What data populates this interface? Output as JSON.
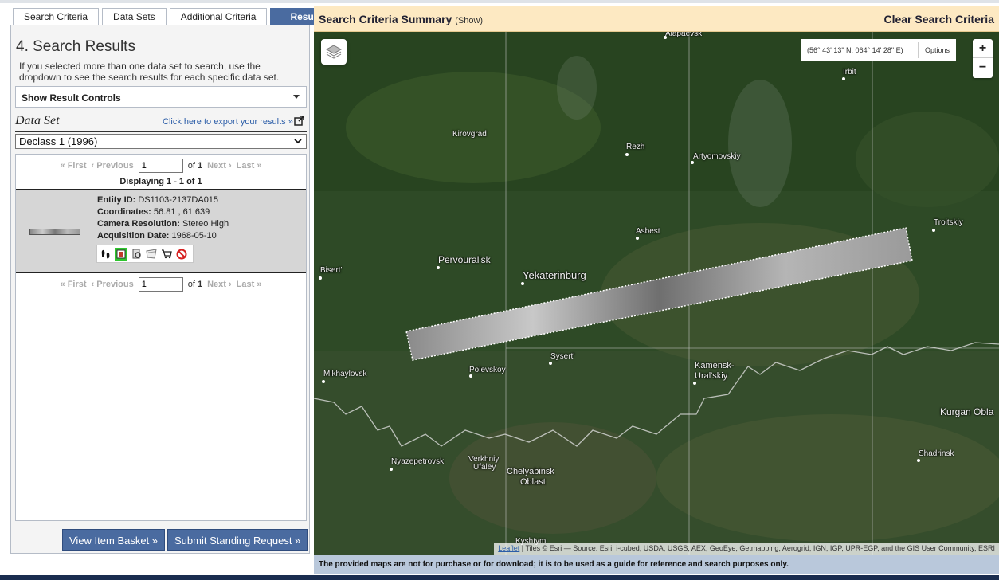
{
  "tabs": [
    {
      "label": "Search Criteria"
    },
    {
      "label": "Data Sets"
    },
    {
      "label": "Additional Criteria"
    },
    {
      "label": "Results"
    }
  ],
  "left": {
    "heading": "4. Search Results",
    "intro": "If you selected more than one data set to search, use the dropdown to see the search results for each specific data set.",
    "result_controls": "Show Result Controls",
    "dataset_label": "Data Set",
    "export_link": "Click here to export your results »",
    "dataset_selected": "Declass 1 (1996)"
  },
  "pager": {
    "first": "« First",
    "previous": "‹ Previous",
    "page": "1",
    "of": "of",
    "total": "1",
    "next": "Next ›",
    "last": "Last »"
  },
  "displaying": "Displaying 1 - 1 of 1",
  "result": {
    "entity_label": "Entity ID:",
    "entity_value": "DS1103-2137DA015",
    "coords_label": "Coordinates:",
    "coords_value": "56.81 , 61.639",
    "res_label": "Camera Resolution:",
    "res_value": "Stereo High",
    "date_label": "Acquisition Date:",
    "date_value": "1968-05-10"
  },
  "buttons": {
    "basket": "View Item Basket »",
    "standing": "Submit Standing Request »"
  },
  "map_header": {
    "title": "Search Criteria Summary",
    "show": "(Show)",
    "clear": "Clear Search Criteria"
  },
  "map": {
    "coordinates": "(56° 43' 13\" N, 064° 14' 28\" E)",
    "options": "Options",
    "zoom_in": "+",
    "zoom_out": "−",
    "leaflet": "Leaflet",
    "attribution": "| Tiles © Esri — Source: Esri, i-cubed, USDA, USGS, AEX, GeoEye, Getmapping, Aerogrid, IGN, IGP, UPR-EGP, and the GIS User Community, ESRI",
    "labels": {
      "alapaevsk": "Alapaevsk",
      "irbit": "Irbit",
      "kirovgrad": "Kirovgrad",
      "rezh": "Rezh",
      "artyomovsky": "Artyomovskiy",
      "asbest": "Asbest",
      "troitskiy": "Troitskiy",
      "pervouralsk": "Pervoural'sk",
      "bisert": "Bisert'",
      "yekaterinburg": "Yekaterinburg",
      "sysert": "Sysert'",
      "polevskoy": "Polevskoy",
      "mikhaylovsk": "Mikhaylovsk",
      "kamensk1": "Kamensk-",
      "kamensk2": "Ural'skiy",
      "kurgan": "Kurgan Obla",
      "shadrinsk": "Shadrinsk",
      "nyazepetrovsk": "Nyazepetrovsk",
      "verkhniy1": "Verkhniy",
      "verkhniy2": "Ufaley",
      "chelyabinsk1": "Chelyabinsk",
      "chelyabinsk2": "Oblast",
      "kyshtym": "Kyshtym"
    }
  },
  "notice": "The provided maps are not for purchase or for download; it is to be used as a guide for reference and search purposes only."
}
